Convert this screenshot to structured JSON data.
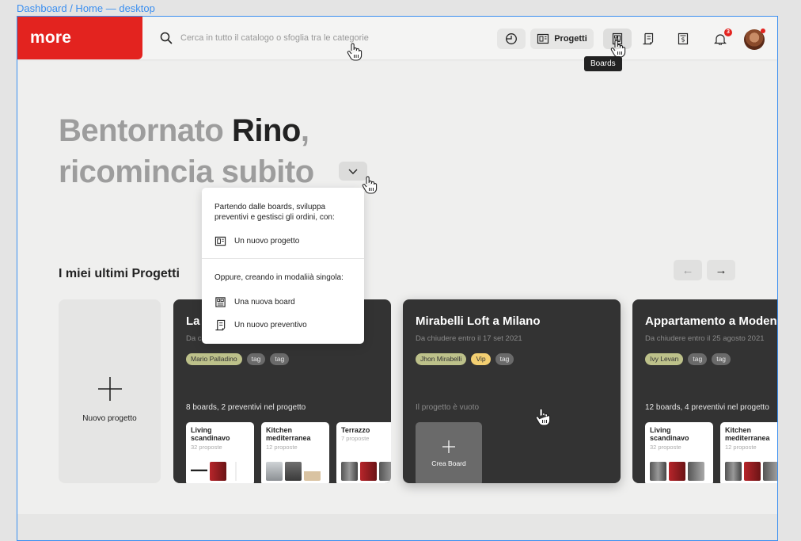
{
  "frame": {
    "label": "Dashboard / Home — desktop"
  },
  "header": {
    "logo": "more",
    "search_placeholder": "Cerca in tutto il catalogo o sfoglia tra le categorie",
    "progetti_label": "Progetti",
    "notifications_count": "3",
    "tooltip": "Boards"
  },
  "hero": {
    "greeting": "Bentornato",
    "name": "Rino",
    "comma": ",",
    "line2": "ricomincia subito"
  },
  "dropdown": {
    "intro": "Partendo dalle boards,  sviluppa preventivi e gestisci gli ordini, con:",
    "new_project": "Un nuovo progetto",
    "intro2": "Oppure, creando in modaliià singola:",
    "new_board": "Una nuova board",
    "new_quote": "Un nuovo preventivo"
  },
  "projects": {
    "title": "I miei ultimi Progetti",
    "prev": "←",
    "next": "→",
    "new_label": "Nuovo progetto",
    "cards": [
      {
        "title": "La",
        "date": "Da c",
        "tags": [
          "Mario Palladino",
          "tag",
          "tag"
        ],
        "stats": "8 boards, 2 preventivi nel progetto",
        "boards": [
          {
            "name": "Living scandinavo",
            "count": "32 proposte"
          },
          {
            "name": "Kitchen mediterranea",
            "count": "12 proposte"
          },
          {
            "name": "Terrazzo",
            "count": "7 proposte"
          }
        ]
      },
      {
        "title": "Mirabelli Loft a Milano",
        "date": "Da chiudere entro il 17 set 2021",
        "tags": [
          "Jhon Mirabelli",
          "Vip",
          "tag"
        ],
        "stats": "Il progetto è vuoto",
        "create_board": "Crea Board"
      },
      {
        "title": "Appartamento a Modena",
        "date": "Da chiudere entro il 25 agosto 2021",
        "tags": [
          "Ivy Levan",
          "tag",
          "tag"
        ],
        "stats": "12 boards, 4 preventivi nel progetto",
        "boards": [
          {
            "name": "Living scandinavo",
            "count": "32 proposte"
          },
          {
            "name": "Kitchen mediterranea",
            "count": "12 proposte"
          }
        ]
      }
    ]
  },
  "colors": {
    "brand": "#e3231f",
    "card_dark": "#333333",
    "tag_client": "#bdc18a",
    "tag_vip": "#f3cf72"
  },
  "icons": [
    "search-icon",
    "clock-icon",
    "project-icon",
    "boards-icon",
    "quote-icon",
    "invoice-icon",
    "bell-icon",
    "chevron-down-icon",
    "plus-icon",
    "hand-cursor-icon"
  ]
}
